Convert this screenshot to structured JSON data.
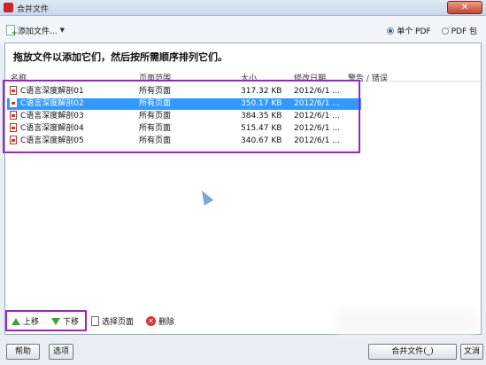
{
  "window": {
    "title": "合并文件",
    "close_label": "✕"
  },
  "toolbar": {
    "add_file_label": "添加文件...",
    "radio_single_pdf": "单个 PDF",
    "radio_pdf_package": "PDF 包"
  },
  "panel": {
    "instruction": "拖放文件以添加它们，然后按所需顺序排列它们。",
    "columns": {
      "name": "名称",
      "page_range": "页面范围",
      "size": "大小",
      "modified": "修改日期",
      "warning": "警告 / 错误"
    },
    "rows": [
      {
        "name": "C语言深度解剖01",
        "range": "所有页面",
        "size": "317.32 KB",
        "date": "2012/6/1 ..."
      },
      {
        "name": "C语言深度解剖02",
        "range": "所有页面",
        "size": "350.17 KB",
        "date": "2012/6/1 ..."
      },
      {
        "name": "C语言深度解剖03",
        "range": "所有页面",
        "size": "384.35 KB",
        "date": "2012/6/1 ..."
      },
      {
        "name": "C语言深度解剖04",
        "range": "所有页面",
        "size": "515.47 KB",
        "date": "2012/6/1 ..."
      },
      {
        "name": "C语言深度解剖05",
        "range": "所有页面",
        "size": "340.67 KB",
        "date": "2012/6/1 ..."
      }
    ],
    "selected_row": 1
  },
  "bottom_tools": {
    "move_up": "上移",
    "move_down": "下移",
    "choose_pages": "选择页面",
    "delete": "删除"
  },
  "footer": {
    "help": "帮助",
    "options": "选项",
    "combine": "合并文件(_)",
    "cancel": "文消"
  },
  "colors": {
    "highlight": "#a020c8",
    "selection": "#3399ff"
  }
}
